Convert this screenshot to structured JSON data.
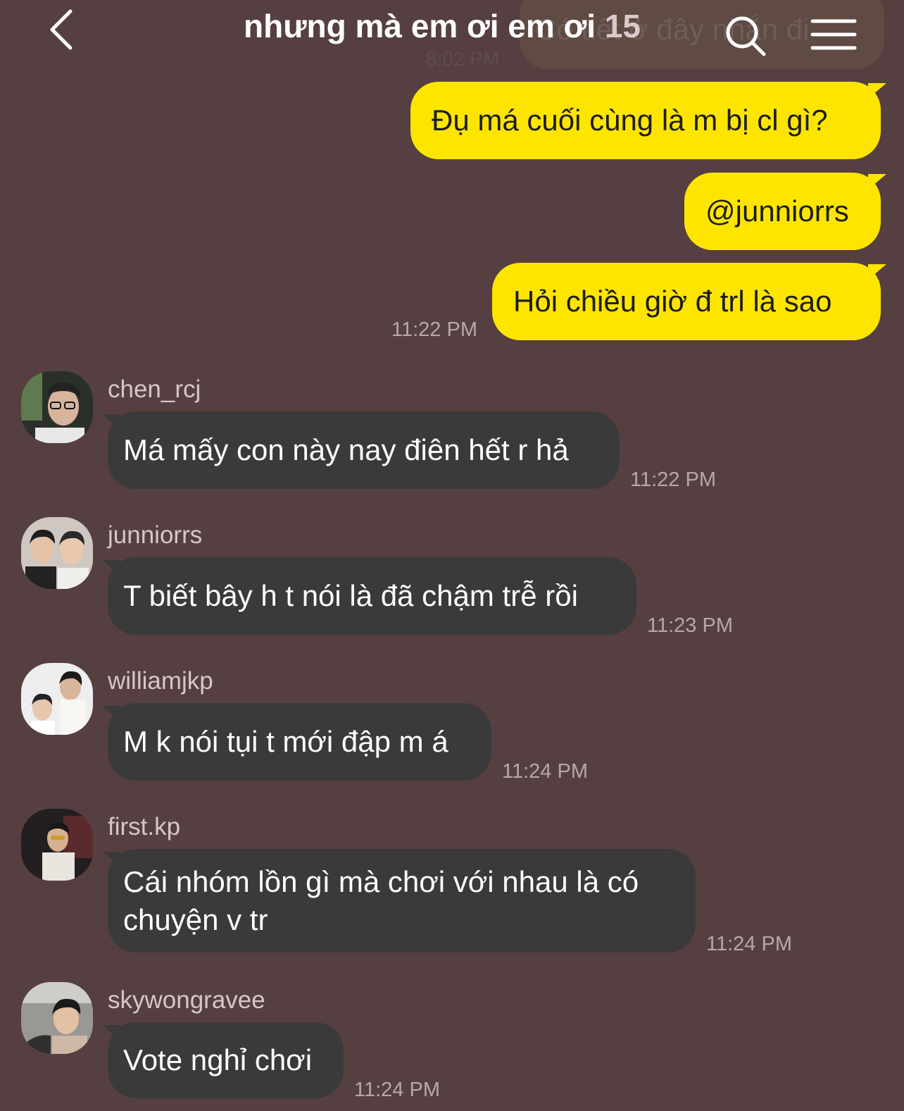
{
  "header": {
    "title": "nhưng mà em ơi em ơi",
    "member_count": "15",
    "back_icon": "chevron-left-icon",
    "search_icon": "search-icon",
    "menu_icon": "menu-icon"
  },
  "scrolled_preview": {
    "text": "Có tiết ở đây nhắn đi",
    "time": "8:02 PM"
  },
  "colors": {
    "background": "#553f41",
    "my_bubble": "#fee500",
    "their_bubble": "#3a3a3a"
  },
  "my_messages": [
    {
      "text": "Đụ má cuối cùng là m bị cl gì?"
    },
    {
      "text": "@junniorrs"
    },
    {
      "text": "Hỏi chiều giờ đ trl là sao",
      "time": "11:22 PM"
    }
  ],
  "their_messages": [
    {
      "sender": "chen_rcj",
      "text": "Má mấy con này nay điên hết r hả",
      "time": "11:22 PM"
    },
    {
      "sender": "junniorrs",
      "text": "T biết bây h t nói là đã chậm trễ rồi",
      "time": "11:23 PM"
    },
    {
      "sender": "williamjkp",
      "text": "M k nói tụi t mới đập m á",
      "time": "11:24 PM"
    },
    {
      "sender": "first.kp",
      "text": "Cái nhóm lồn gì mà chơi với nhau là có chuyện v tr",
      "time": "11:24 PM"
    },
    {
      "sender": "skywongravee",
      "text": "Vote nghỉ chơi",
      "time": "11:24 PM"
    }
  ]
}
